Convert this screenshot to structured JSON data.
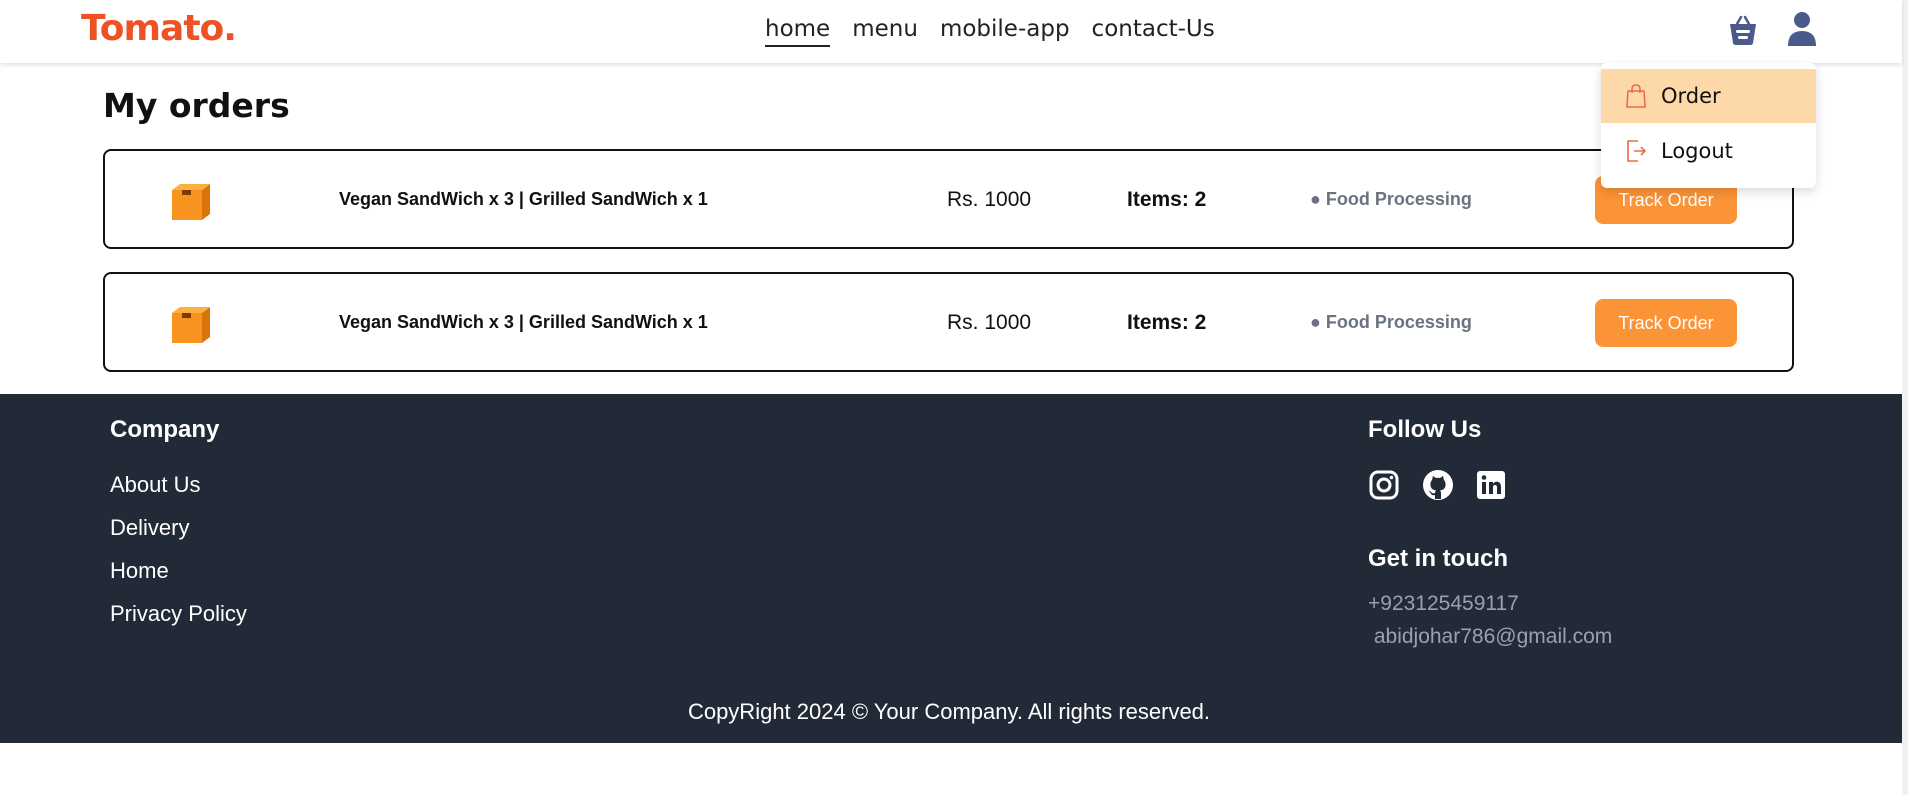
{
  "header": {
    "logo": "Tomato.",
    "nav": [
      "home",
      "menu",
      "mobile-app",
      "contact-Us"
    ]
  },
  "dropdown": {
    "items": [
      "Order",
      "Logout"
    ]
  },
  "page": {
    "title": "My orders"
  },
  "orders": [
    {
      "items": "Vegan SandWich x 3 | Grilled SandWich x 1",
      "price": "Rs. 1000",
      "count": "Items: 2",
      "status": "● Food Processing",
      "button": "Track Order"
    },
    {
      "items": "Vegan SandWich x 3 | Grilled SandWich x 1",
      "price": "Rs. 1000",
      "count": "Items: 2",
      "status": "● Food Processing",
      "button": "Track Order"
    }
  ],
  "footer": {
    "company_heading": "Company",
    "links": [
      "About Us",
      "Delivery",
      "Home",
      "Privacy Policy"
    ],
    "follow_heading": "Follow Us",
    "social_icons": [
      "instagram-icon",
      "github-icon",
      "linkedin-icon"
    ],
    "touch_heading": "Get in touch",
    "phone": "+923125459117",
    "email": " abidjohar786@gmail.com",
    "copyright": "CopyRight 2024 © Your Company. All rights reserved."
  },
  "colors": {
    "brand": "#ee5124",
    "button": "#fb9337",
    "footer_bg": "#222a38",
    "dropdown_active": "#fdd9aa"
  }
}
